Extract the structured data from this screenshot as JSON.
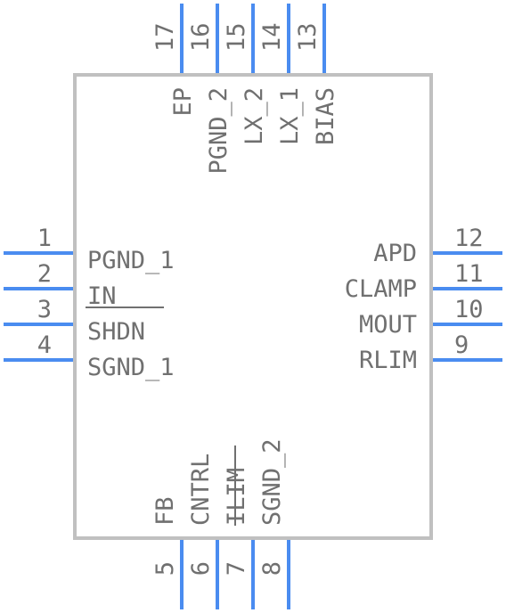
{
  "component": {
    "body_color": "#c0c0c0",
    "pin_color": "#4a8cf0",
    "text_color": "#707070"
  },
  "pins": {
    "left": [
      {
        "number": "1",
        "name": "PGND_1",
        "overline": false
      },
      {
        "number": "2",
        "name": "IN",
        "overline": false
      },
      {
        "number": "3",
        "name": "SHDN",
        "overline": true
      },
      {
        "number": "4",
        "name": "SGND_1",
        "overline": false
      }
    ],
    "right": [
      {
        "number": "12",
        "name": "APD",
        "overline": false
      },
      {
        "number": "11",
        "name": "CLAMP",
        "overline": false
      },
      {
        "number": "10",
        "name": "MOUT",
        "overline": false
      },
      {
        "number": "9",
        "name": "RLIM",
        "overline": false
      }
    ],
    "top": [
      {
        "number": "17",
        "name": "EP",
        "overline": false
      },
      {
        "number": "16",
        "name": "PGND_2",
        "overline": false
      },
      {
        "number": "15",
        "name": "LX_2",
        "overline": false
      },
      {
        "number": "14",
        "name": "LX_1",
        "overline": false
      },
      {
        "number": "13",
        "name": "BIAS",
        "overline": false
      }
    ],
    "bottom": [
      {
        "number": "5",
        "name": "FB",
        "overline": false
      },
      {
        "number": "6",
        "name": "CNTRL",
        "overline": false
      },
      {
        "number": "7",
        "name": "ILIM",
        "overline": true
      },
      {
        "number": "8",
        "name": "SGND_2",
        "overline": false
      }
    ]
  }
}
